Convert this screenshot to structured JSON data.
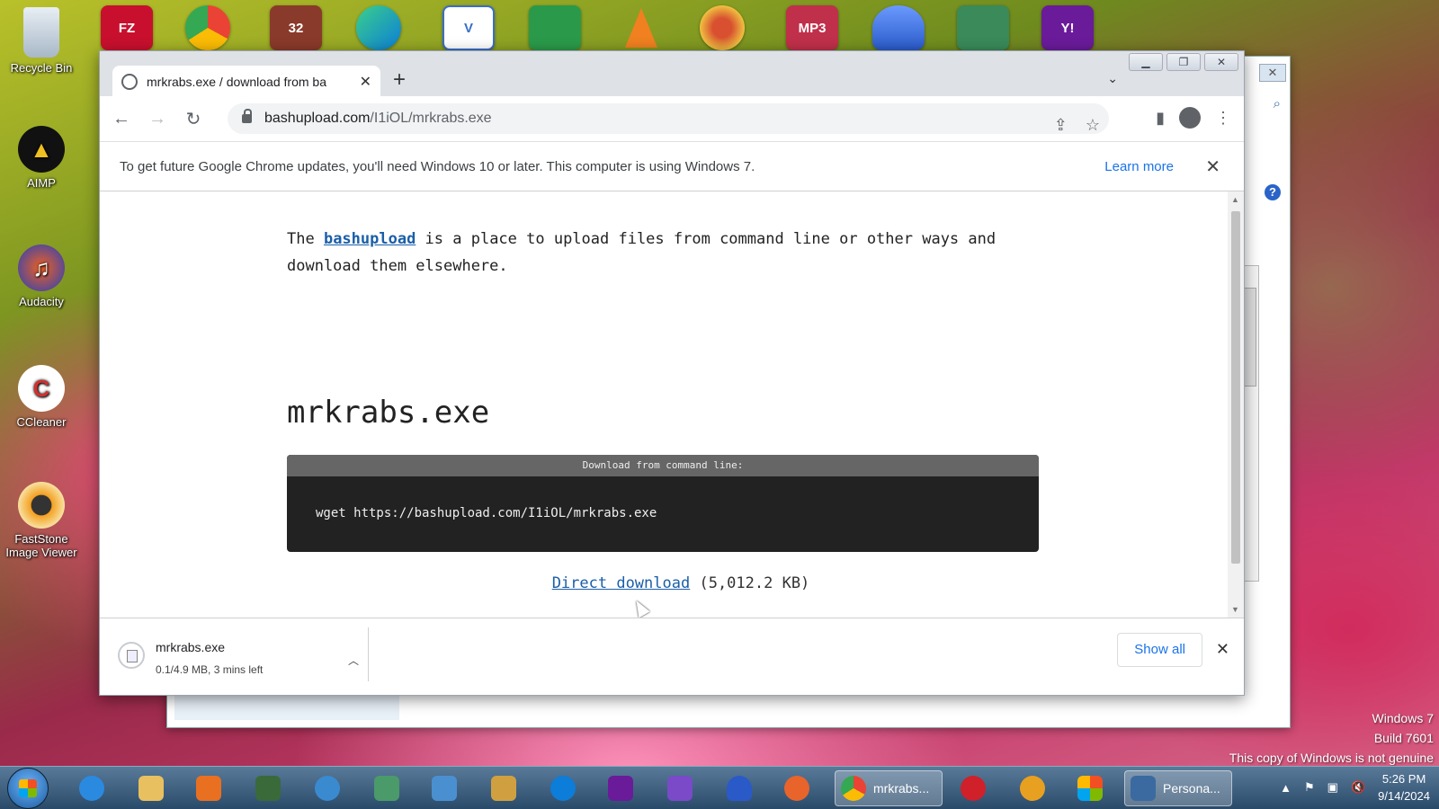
{
  "desktop": {
    "left_icons": [
      {
        "label": "Recycle Bin",
        "icon": "recycle-bin-icon",
        "color": "#c9d6e2"
      },
      {
        "label": "AIMP",
        "icon": "aimp-icon",
        "color": "#f0c020"
      },
      {
        "label": "Audacity",
        "icon": "audacity-icon",
        "color": "#e85020"
      },
      {
        "label": "CCleaner",
        "icon": "ccleaner-icon",
        "color": "#d03030"
      },
      {
        "label": "FastStone Image Viewer",
        "icon": "faststone-icon",
        "color": "#f4a020"
      }
    ],
    "top_icons": [
      {
        "icon": "filezilla-icon",
        "color": "#c8102e",
        "text": "FZ"
      },
      {
        "icon": "chrome-icon",
        "color": "#34a853",
        "text": ""
      },
      {
        "icon": "game-icon",
        "color": "#8a3a2a",
        "text": "32"
      },
      {
        "icon": "edge-icon",
        "color": "#0c7dd8",
        "text": ""
      },
      {
        "icon": "vnc-icon",
        "color": "#3a6ec8",
        "text": "V"
      },
      {
        "icon": "bird-icon",
        "color": "#2a9a4a",
        "text": ""
      },
      {
        "icon": "vlc-icon",
        "color": "#f08020",
        "text": ""
      },
      {
        "icon": "sun-icon",
        "color": "#d85030",
        "text": ""
      },
      {
        "icon": "mp3-icon",
        "color": "#c0304a",
        "text": "MP3"
      },
      {
        "icon": "flame-icon",
        "color": "#2a5ac8",
        "text": ""
      },
      {
        "icon": "zombie-icon",
        "color": "#3a8a5a",
        "text": ""
      },
      {
        "icon": "yahoo-messenger-icon",
        "color": "#6a1b9a",
        "text": "Y!"
      }
    ]
  },
  "browser": {
    "tab_title": "mrkrabs.exe / download from ba",
    "url_host": "bashupload.com",
    "url_path": "/I1iOL/mrkrabs.exe",
    "infobar_text": "To get future Google Chrome updates, you'll need Windows 10 or later. This computer is using Windows 7.",
    "infobar_link": "Learn more"
  },
  "page": {
    "intro_before": "The ",
    "intro_link": "bashupload",
    "intro_after": " is a place to upload files from command line or other ways and download them elsewhere.",
    "file_name": "mrkrabs.exe",
    "cmd_header": "Download from command line:",
    "cmd_text": "wget https://bashupload.com/I1iOL/mrkrabs.exe",
    "direct_link": "Direct download",
    "file_size": "(5,012.2 KB)"
  },
  "downloads_bar": {
    "file_name": "mrkrabs.exe",
    "status": "0.1/4.9 MB, 3 mins left",
    "show_all": "Show all"
  },
  "watermark": {
    "line1": "Windows 7",
    "line2": "Build 7601",
    "line3": "This copy of Windows is not genuine"
  },
  "taskbar": {
    "apps": [
      {
        "icon": "internet-explorer-icon",
        "color": "#2a8ae0"
      },
      {
        "icon": "file-explorer-icon",
        "color": "#e8c060"
      },
      {
        "icon": "media-player-icon",
        "color": "#e87020"
      },
      {
        "icon": "terminal-icon",
        "color": "#3a6a3a"
      },
      {
        "icon": "globe-icon",
        "color": "#3a8ad0"
      },
      {
        "icon": "notepad-icon",
        "color": "#4a9a6a"
      },
      {
        "icon": "users-icon",
        "color": "#4a90d0"
      },
      {
        "icon": "paint-icon",
        "color": "#d0a040"
      },
      {
        "icon": "edge-icon",
        "color": "#0c7dd8"
      },
      {
        "icon": "yahoo-messenger-icon",
        "color": "#6a1b9a"
      },
      {
        "icon": "visual-studio-icon",
        "color": "#7a4ac8"
      },
      {
        "icon": "flame-icon",
        "color": "#2a5ac8"
      },
      {
        "icon": "firefox-icon",
        "color": "#e8642a"
      }
    ],
    "active_chrome_label": "mrkrabs...",
    "after_apps": [
      {
        "icon": "opera-icon",
        "color": "#d0202a"
      },
      {
        "icon": "circle-icon",
        "color": "#e8a020"
      },
      {
        "icon": "windows-logo-icon",
        "color": "#2a8ae0"
      }
    ],
    "active_personalize_label": "Persona...",
    "clock_time": "5:26 PM",
    "clock_date": "9/14/2024"
  }
}
